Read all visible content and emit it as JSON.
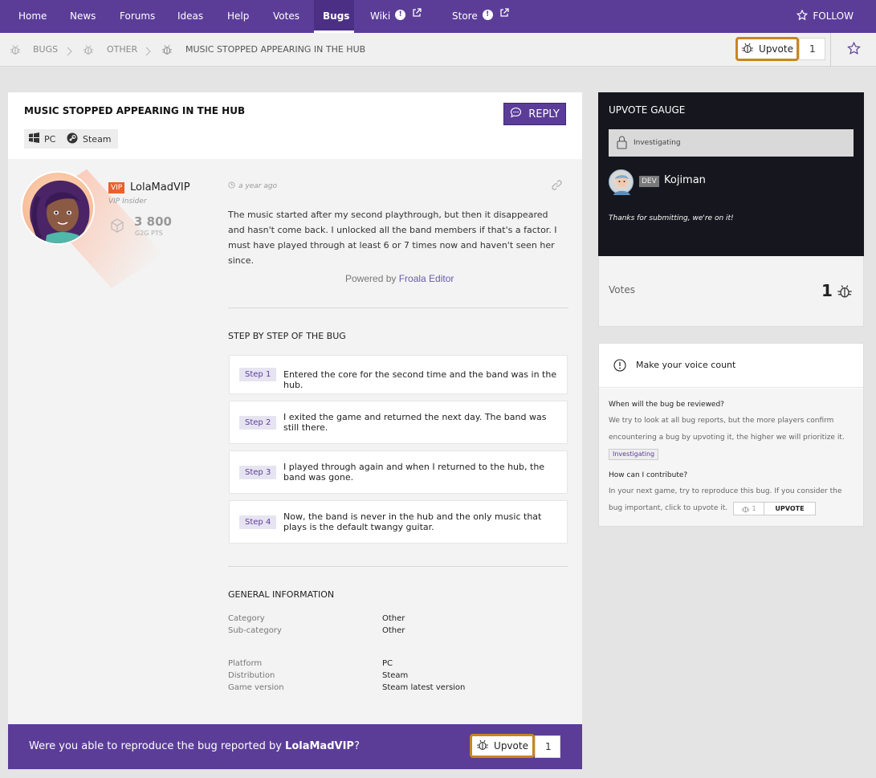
{
  "nav": {
    "items": [
      {
        "label": "Home"
      },
      {
        "label": "News"
      },
      {
        "label": "Forums"
      },
      {
        "label": "Ideas"
      },
      {
        "label": "Help"
      },
      {
        "label": "Votes"
      },
      {
        "label": "Bugs"
      },
      {
        "label": "Wiki"
      },
      {
        "label": "Store"
      }
    ],
    "follow_label": "FOLLOW"
  },
  "breadcrumb": {
    "items": [
      "BUGS",
      "OTHER",
      "MUSIC STOPPED APPEARING IN THE HUB"
    ],
    "upvote_label": "Upvote",
    "upvote_count": "1"
  },
  "post": {
    "title": "MUSIC STOPPED APPEARING IN THE HUB",
    "tags": [
      "PC",
      "Steam"
    ],
    "reply_label": "REPLY",
    "author": {
      "badge": "VIP",
      "name": "LolaMadVIP",
      "role": "VIP Insider",
      "points": "3 800",
      "points_label": "G2G PTS"
    },
    "time": "a year ago",
    "body": "The music started after my second playthrough, but then it disappeared and hasn't come back. I unlocked all the band members if that's a factor. I must have played through at least 6 or 7 times now and haven't seen her since.",
    "powered_prefix": "Powered by ",
    "powered_link": "Froala Editor",
    "steps_title": "STEP BY STEP OF THE BUG",
    "steps": [
      {
        "label": "Step 1",
        "text": "Entered the core for the second time and the band was in the hub."
      },
      {
        "label": "Step 2",
        "text": "I exited the game and returned the next day. The band was still there."
      },
      {
        "label": "Step 3",
        "text": "I played through again and when I returned to the hub, the band was gone."
      },
      {
        "label": "Step 4",
        "text": "Now, the band is never in the hub and the only music that plays is the default twangy guitar."
      }
    ],
    "general_title": "GENERAL INFORMATION",
    "general": [
      {
        "key": "Category",
        "value": "Other"
      },
      {
        "key": "Sub-category",
        "value": "Other"
      },
      {
        "key": "Platform",
        "value": "PC"
      },
      {
        "key": "Distribution",
        "value": "Steam"
      },
      {
        "key": "Game version",
        "value": "Steam latest version"
      }
    ]
  },
  "reproduce": {
    "prefix": "Were you able to reproduce the bug reported by ",
    "user": "LolaMadVIP",
    "suffix": "?",
    "upvote_label": "Upvote",
    "count": "1"
  },
  "gauge": {
    "title": "UPVOTE GAUGE",
    "status": "Investigating",
    "dev_badge": "DEV",
    "dev_name": "Kojiman",
    "message": "Thanks for submitting, we're on it!",
    "votes_label": "Votes",
    "votes_count": "1"
  },
  "voice": {
    "title": "Make your voice count",
    "q1": "When will the bug be reviewed?",
    "a1": "We try to look at all bug reports, but the more players confirm encountering a bug by upvoting it, the higher we will prioritize it.",
    "a1_tag": "Investigating",
    "q2": "How can I contribute?",
    "a2": "In your next game, try to reproduce this bug. If you consider the bug important, click to upvote it.",
    "mini_count": "1",
    "mini_label": "UPVOTE"
  },
  "colors": {
    "brand": "#5b3d98",
    "highlight": "#c8861e",
    "gauge_bg": "#16161f"
  }
}
